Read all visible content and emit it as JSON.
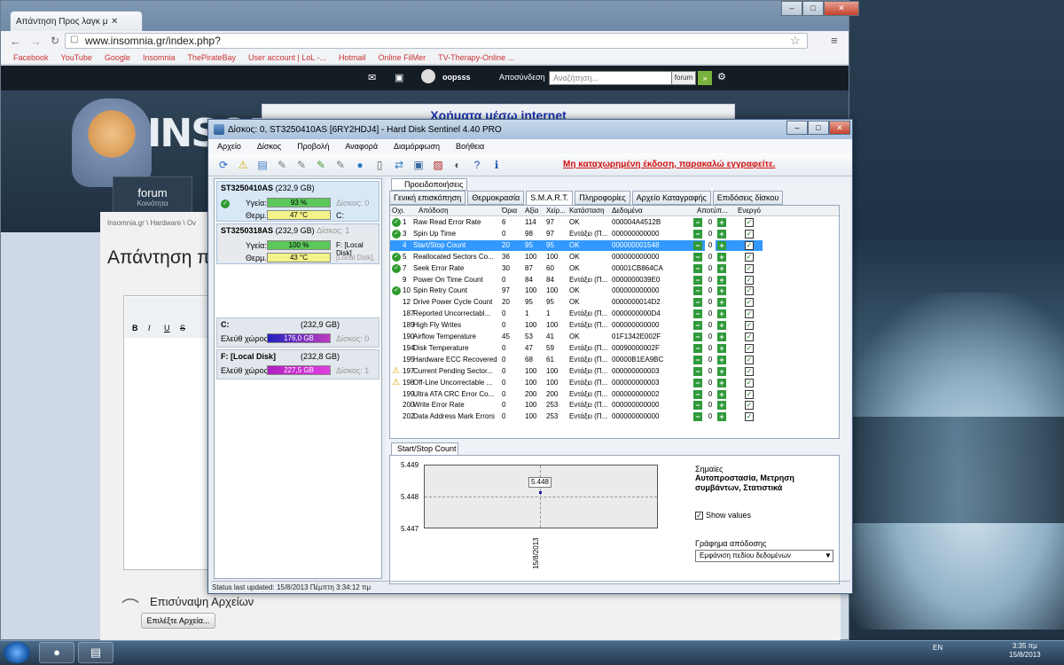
{
  "browser": {
    "tab_title": "Απάντηση Προς λαγκ μ",
    "url": "www.insomnia.gr/index.php?",
    "bookmarks": [
      "Facebook",
      "YouTube",
      "Google",
      "Insomnia",
      "ThePirateBay",
      "User account | LoL -...",
      "Hotmail",
      "Online FilMer",
      "TV-Therapy-Online ..."
    ]
  },
  "site": {
    "username": "oopsss",
    "logout": "Αποσύνδεση",
    "search_placeholder": "Αναζήτηση...",
    "search_scope": "forum",
    "logo": "INSOMNIA",
    "ad_text": "Χρήματα μέσω internet",
    "forum_tab": "forum",
    "forum_sub": "Κοινότητα",
    "breadcrumb": "Insomnia.gr  \\  Hardware  \\  Ov",
    "page_title": "Απάντηση π",
    "attach_title": "Επισύναψη Αρχείων",
    "attach_button": "Επιλέξτε Αρχεία..."
  },
  "hds": {
    "title": "Δίσκος: 0, ST3250410AS [6RY2HDJ4]  -  Hard Disk Sentinel 4.40 PRO",
    "menu": [
      "Αρχείο",
      "Δίσκος",
      "Προβολή",
      "Αναφορά",
      "Διαμόρφωση",
      "Βοήθεια"
    ],
    "warning": "Μη καταχωρημένη έκδοση, παρακαλώ εγγραφείτε.",
    "disks": [
      {
        "name": "ST3250410AS",
        "size": "(232,9 GB)",
        "disk_no": "Δίσκος: 0",
        "health_label": "Υγεία:",
        "health": "93 %",
        "temp_label": "Θερμ.:",
        "temp": "47 °C",
        "drive": "C:"
      },
      {
        "name": "ST3250318AS",
        "size": "(232,9 GB)",
        "disk_no": "Δίσκος: 1",
        "health_label": "Υγεία:",
        "health": "100 %",
        "temp_label": "Θερμ.:",
        "temp": "43 °C",
        "drive": "F: [Local Disk]",
        "drive2": "[Local Disk],"
      }
    ],
    "partitions": [
      {
        "name": "C:",
        "size": "(232,9 GB)",
        "free_label": "Ελεύθ χώρος",
        "free": "176,0 GB",
        "disk": "Δίσκος: 0"
      },
      {
        "name": "F: [Local Disk]",
        "size": "(232,8 GB)",
        "free_label": "Ελεύθ χώρος",
        "free": "227,5 GB",
        "disk": "Δίσκος: 1"
      }
    ],
    "prov_tab": "Προειδοποιήσεις",
    "tabs": [
      "Γενική επισκόπηση",
      "Θερμοκρασία",
      "S.M.A.R.T.",
      "Πληροφορίες",
      "Αρχείο Καταγραφής",
      "Επιδόσεις δίσκου"
    ],
    "columns": [
      "Οχι.",
      "Απόδοση",
      "Όρια",
      "Αξία",
      "Χείρ...",
      "Κατάσταση",
      "Δεδομένα",
      "Αποτύπ...",
      "Ενεργό"
    ],
    "rows": [
      {
        "id": "1",
        "name": "Raw Read Error Rate",
        "thr": "6",
        "val": "114",
        "worst": "97",
        "status": "OK",
        "data": "000004A4512B",
        "offset": "0",
        "icon": "ok"
      },
      {
        "id": "3",
        "name": "Spin Up Time",
        "thr": "0",
        "val": "98",
        "worst": "97",
        "status": "Εντάξει (Π...",
        "data": "000000000000",
        "offset": "0",
        "icon": "ok"
      },
      {
        "id": "4",
        "name": "Start/Stop Count",
        "thr": "20",
        "val": "95",
        "worst": "95",
        "status": "OK",
        "data": "000000001548",
        "offset": "0",
        "icon": "none"
      },
      {
        "id": "5",
        "name": "Reallocated Sectors Co...",
        "thr": "36",
        "val": "100",
        "worst": "100",
        "status": "OK",
        "data": "000000000000",
        "offset": "0",
        "icon": "ok"
      },
      {
        "id": "7",
        "name": "Seek Error Rate",
        "thr": "30",
        "val": "87",
        "worst": "60",
        "status": "OK",
        "data": "00001CB864CA",
        "offset": "0",
        "icon": "ok"
      },
      {
        "id": "9",
        "name": "Power On Time Count",
        "thr": "0",
        "val": "84",
        "worst": "84",
        "status": "Εντάξει (Π...",
        "data": "0000000039E0",
        "offset": "0",
        "icon": "none"
      },
      {
        "id": "10",
        "name": "Spin Retry Count",
        "thr": "97",
        "val": "100",
        "worst": "100",
        "status": "OK",
        "data": "000000000000",
        "offset": "0",
        "icon": "ok"
      },
      {
        "id": "12",
        "name": "Drive Power Cycle Count",
        "thr": "20",
        "val": "95",
        "worst": "95",
        "status": "OK",
        "data": "0000000014D2",
        "offset": "0",
        "icon": "none"
      },
      {
        "id": "187",
        "name": "Reported Uncorrectabl...",
        "thr": "0",
        "val": "1",
        "worst": "1",
        "status": "Εντάξει (Π...",
        "data": "0000000000D4",
        "offset": "0",
        "icon": "none"
      },
      {
        "id": "189",
        "name": "High Fly Writes",
        "thr": "0",
        "val": "100",
        "worst": "100",
        "status": "Εντάξει (Π...",
        "data": "000000000000",
        "offset": "0",
        "icon": "none"
      },
      {
        "id": "190",
        "name": "Airflow Temperature",
        "thr": "45",
        "val": "53",
        "worst": "41",
        "status": "OK",
        "data": "01F1342E002F",
        "offset": "0",
        "icon": "none"
      },
      {
        "id": "194",
        "name": "Disk Temperature",
        "thr": "0",
        "val": "47",
        "worst": "59",
        "status": "Εντάξει (Π...",
        "data": "00090000002F",
        "offset": "0",
        "icon": "none"
      },
      {
        "id": "195",
        "name": "Hardware ECC Recovered",
        "thr": "0",
        "val": "68",
        "worst": "61",
        "status": "Εντάξει (Π...",
        "data": "00000B1EA9BC",
        "offset": "0",
        "icon": "none"
      },
      {
        "id": "197",
        "name": "Current Pending Sector...",
        "thr": "0",
        "val": "100",
        "worst": "100",
        "status": "Εντάξει (Π...",
        "data": "000000000003",
        "offset": "0",
        "icon": "warn"
      },
      {
        "id": "198",
        "name": "Off-Line Uncorrectable ...",
        "thr": "0",
        "val": "100",
        "worst": "100",
        "status": "Εντάξει (Π...",
        "data": "000000000003",
        "offset": "0",
        "icon": "warn"
      },
      {
        "id": "199",
        "name": "Ultra ATA CRC Error Co...",
        "thr": "0",
        "val": "200",
        "worst": "200",
        "status": "Εντάξει (Π...",
        "data": "000000000002",
        "offset": "0",
        "icon": "none"
      },
      {
        "id": "200",
        "name": "Write Error Rate",
        "thr": "0",
        "val": "100",
        "worst": "253",
        "status": "Εντάξει (Π...",
        "data": "000000000000",
        "offset": "0",
        "icon": "none"
      },
      {
        "id": "202",
        "name": "Data Address Mark Errors",
        "thr": "0",
        "val": "100",
        "worst": "253",
        "status": "Εντάξει (Π...",
        "data": "000000000000",
        "offset": "0",
        "icon": "none"
      }
    ],
    "graph_tab": "Start/Stop Count",
    "graph_y": [
      "5.449",
      "5.448",
      "5.447"
    ],
    "graph_point_label": "5.448",
    "graph_date": "15/8/2013",
    "legend_title": "Σημαίες",
    "legend_value": "Αυτοπροστασία, Μετρηση συμβάντων, Στατιστικά",
    "show_values": "Show values",
    "graph_mode_label": "Γράφημα απόδοσης",
    "graph_mode": "Εμφάνιση πεδίου δεδομένων",
    "status": "Status last updated: 15/8/2013 Πέμπτη 3:34:12 πμ"
  },
  "taskbar": {
    "lang": "EN",
    "time": "3:35 πμ",
    "date": "15/8/2013"
  }
}
